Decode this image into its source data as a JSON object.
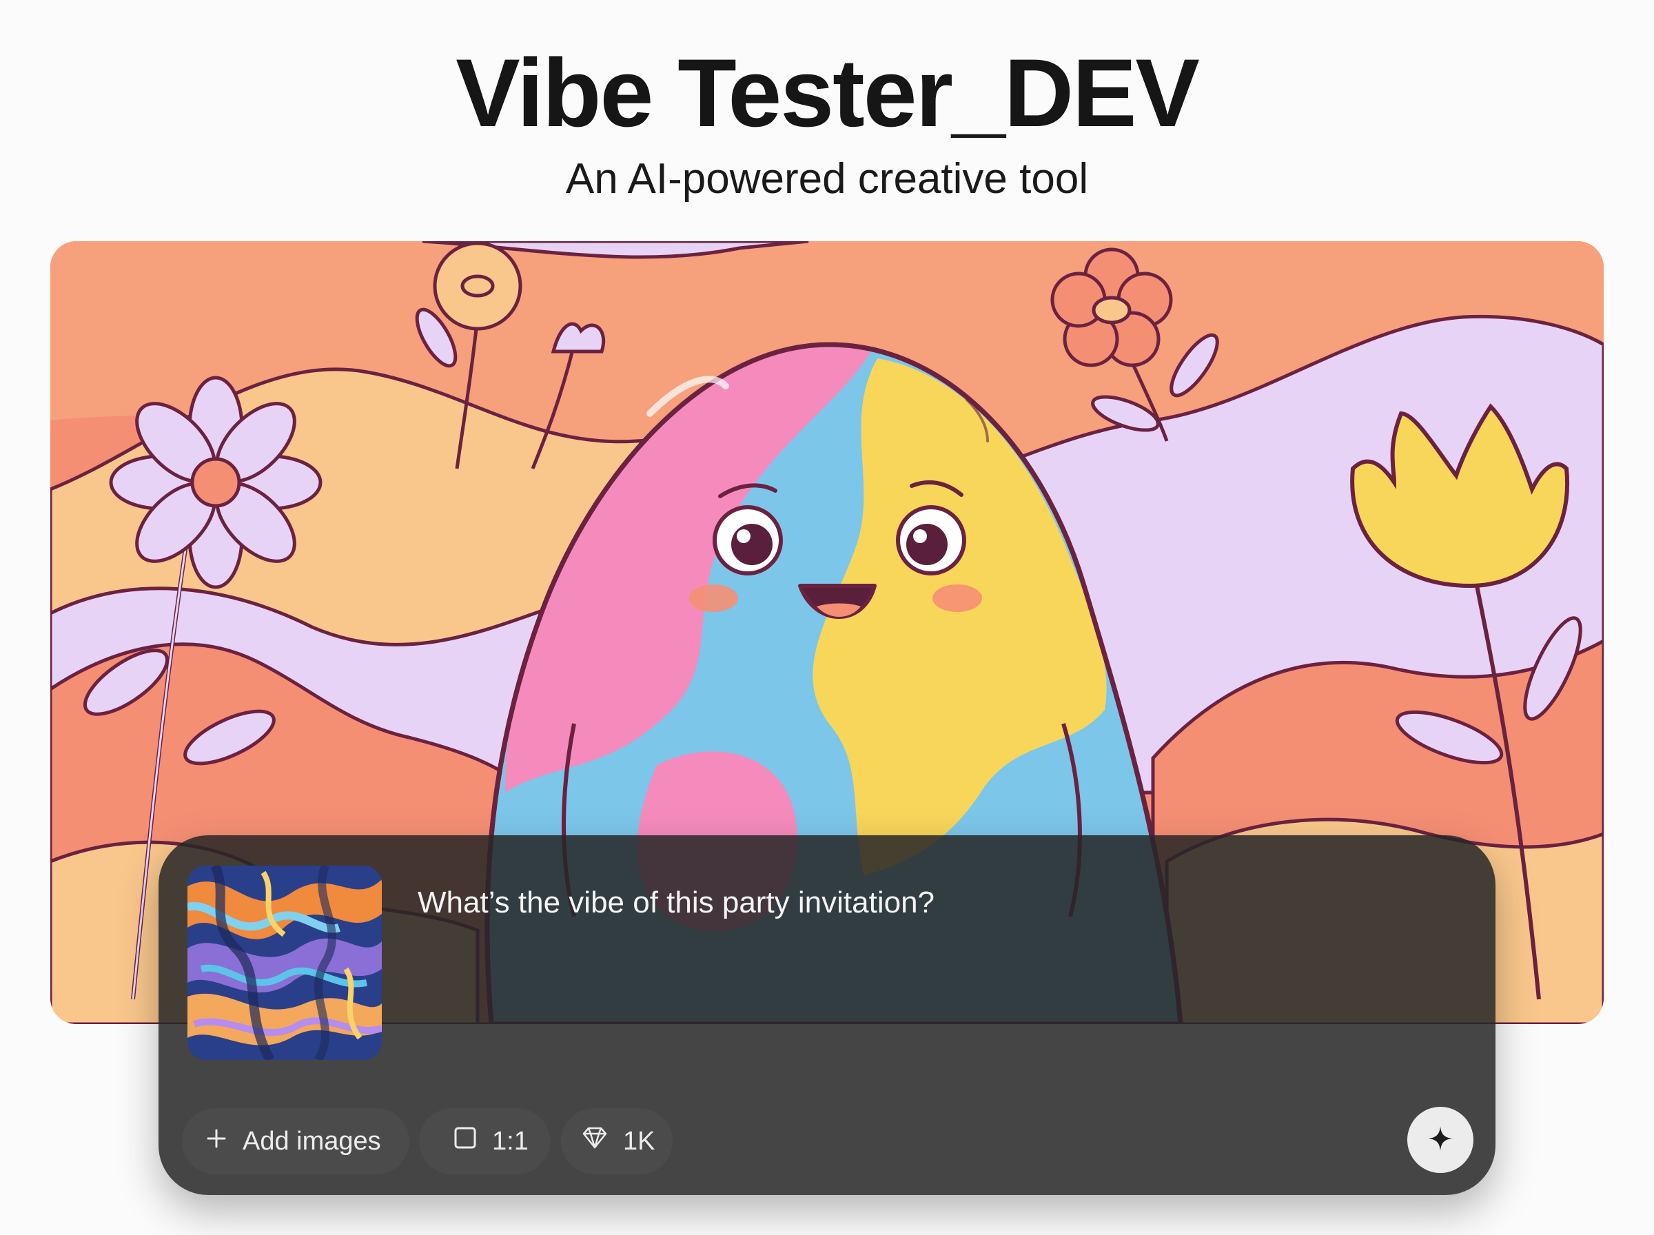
{
  "header": {
    "title": "Vibe Tester_DEV",
    "subtitle": "An AI-powered creative tool"
  },
  "hero": {
    "description_icon": "cartoon-blob-character-illustration"
  },
  "composer": {
    "thumbnail_icon": "marbled-swirl-thumbnail",
    "prompt_text": "What’s the vibe of this party invitation?",
    "add_images_label": "Add images",
    "add_icon": "plus-icon",
    "aspect_ratio_label": "1:1",
    "aspect_icon": "square-icon",
    "resolution_label": "1K",
    "resolution_icon": "diamond-icon",
    "send_icon": "sparkle-icon"
  },
  "colors": {
    "background": "#fbfbfb",
    "hero_coral": "#f58f74",
    "hero_peach": "#f9c78c",
    "hero_lavender": "#e7d3f5",
    "composer_bg": "#262626",
    "character_blue": "#7cc6ea",
    "character_pink": "#f58bbd",
    "character_yellow": "#f8d65a"
  }
}
